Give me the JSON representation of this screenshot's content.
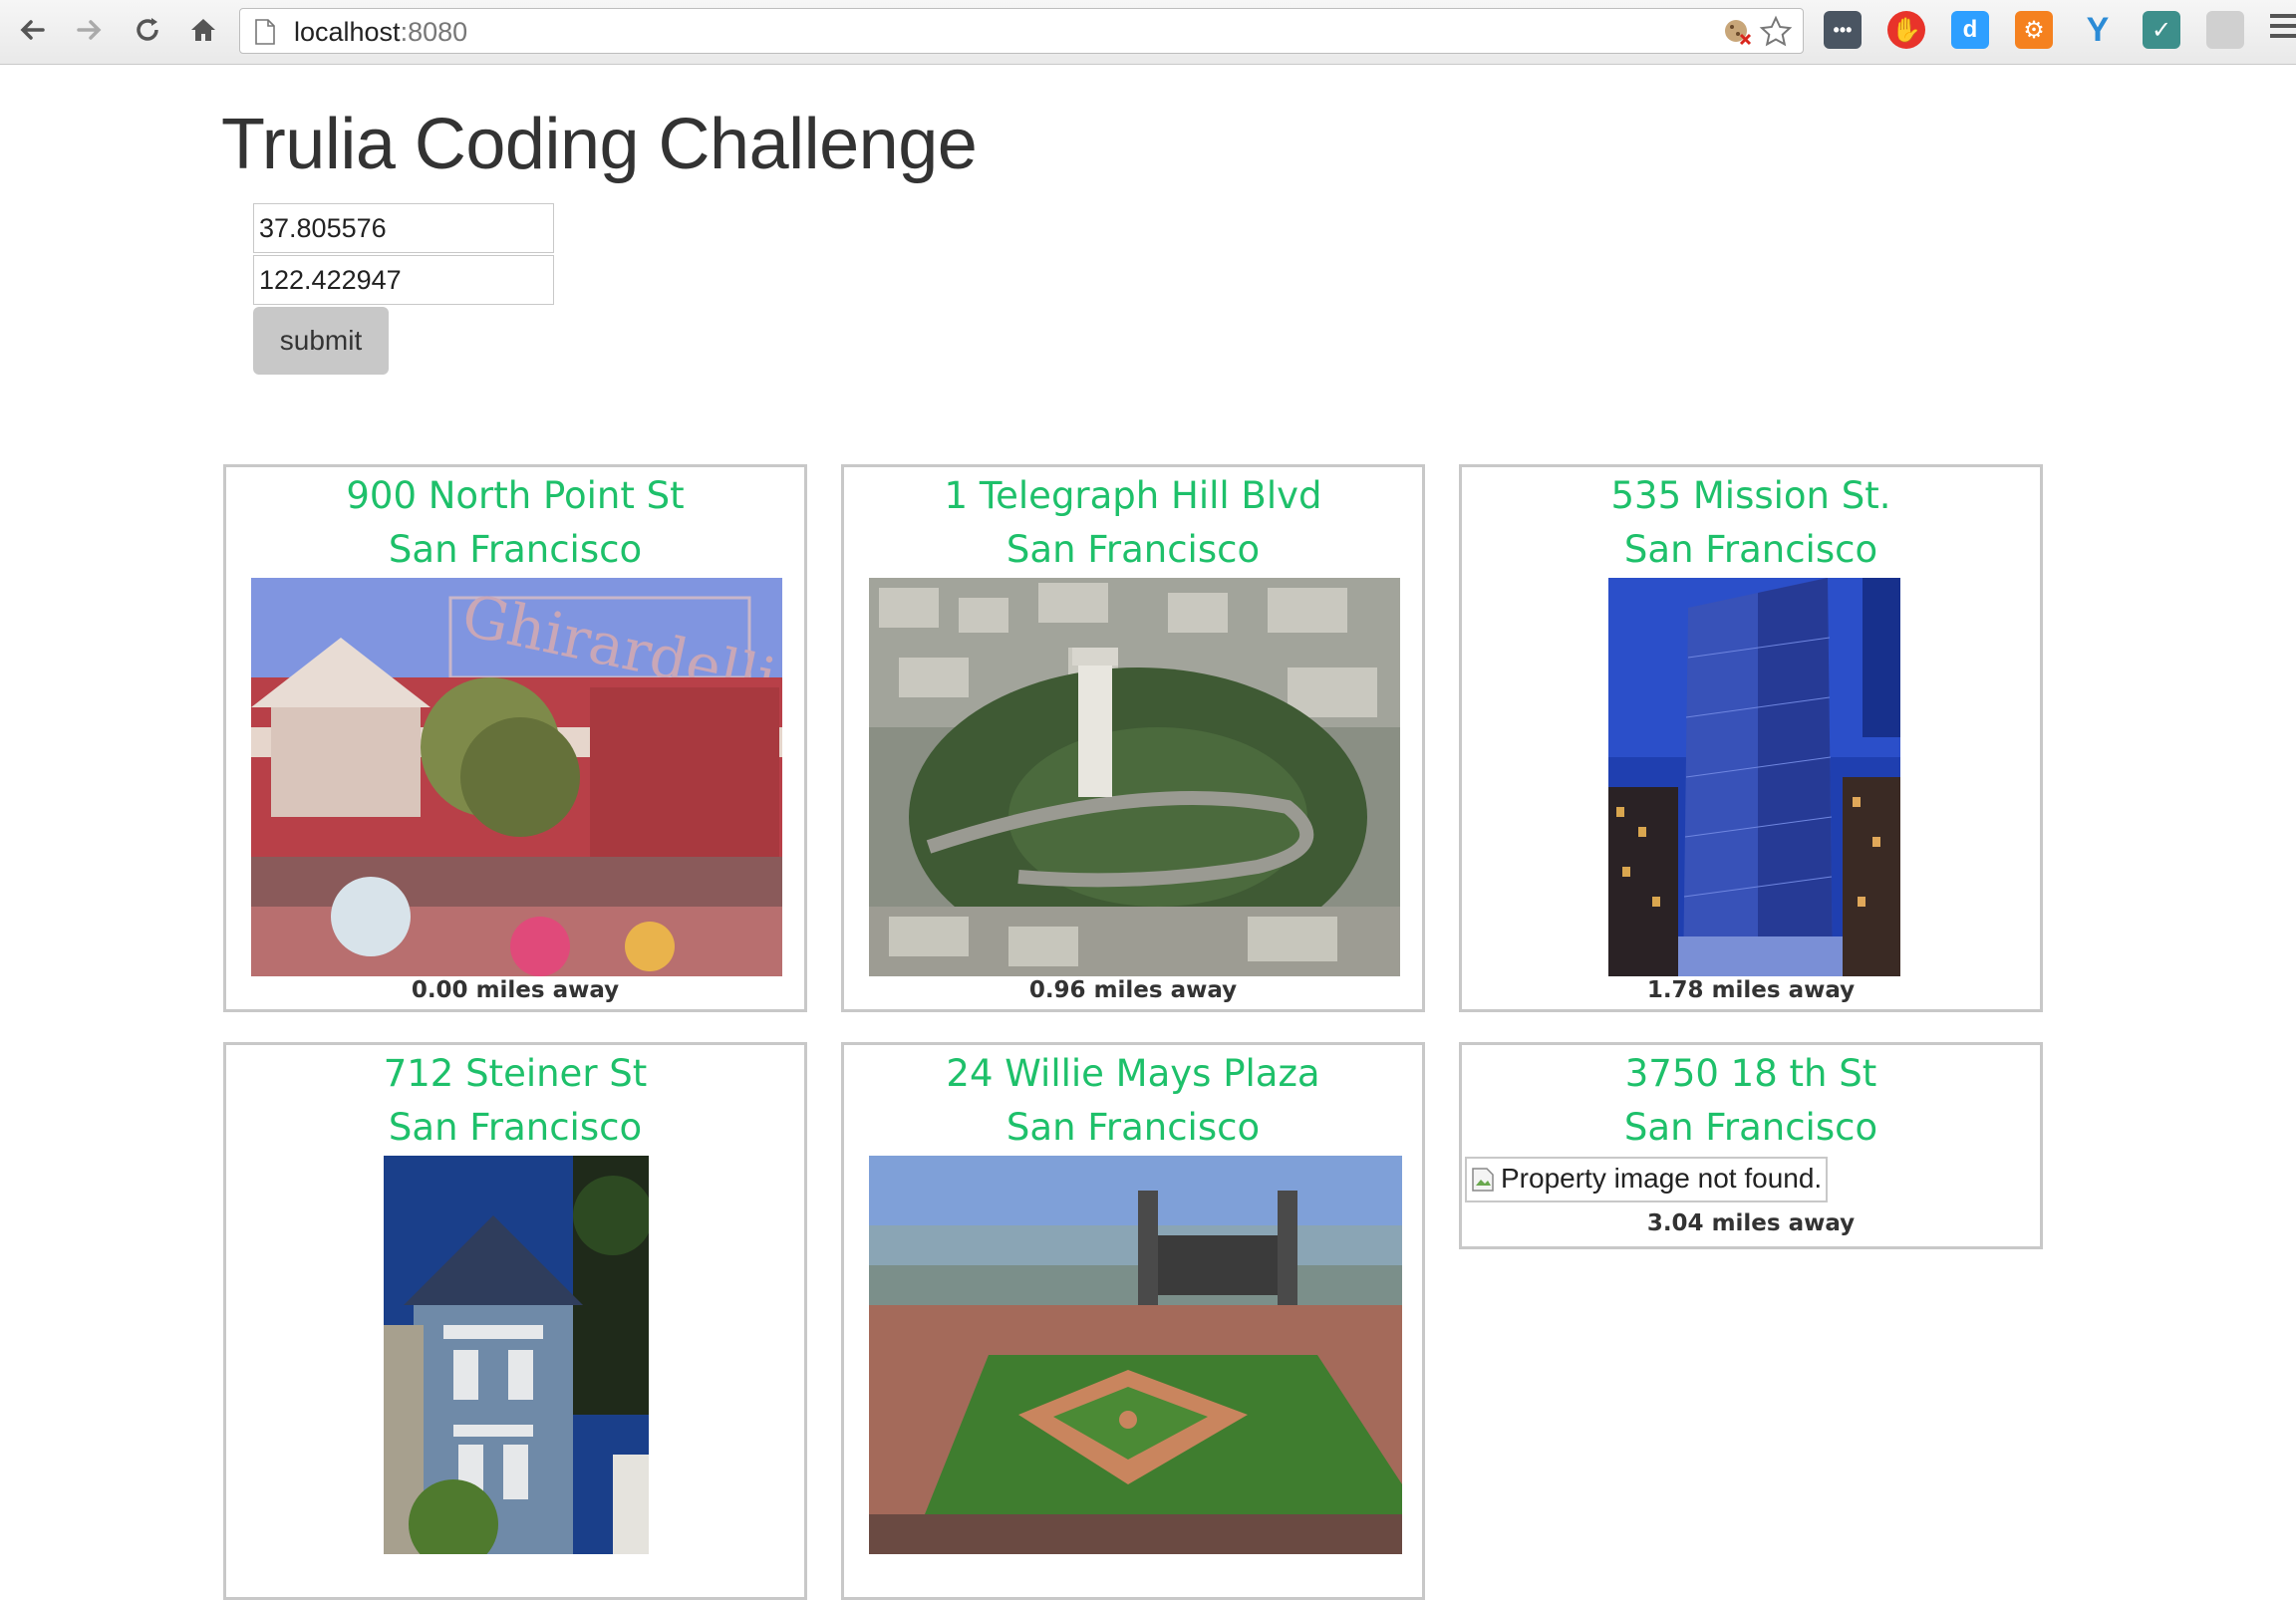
{
  "browser": {
    "url_host": "localhost",
    "url_port": ":8080",
    "icons": [
      "back-icon",
      "forward-icon",
      "reload-icon",
      "home-icon",
      "page-icon",
      "cookie-blocked-icon",
      "bookmark-star-icon",
      "menu-icon"
    ],
    "extensions": [
      {
        "name": "ellipsis-extension",
        "glyph": "•••",
        "color": "#4a5562"
      },
      {
        "name": "adblock-extension",
        "glyph": "✋",
        "color": "#e8332a"
      },
      {
        "name": "disqus-extension",
        "glyph": "d",
        "color": "#2e9fff"
      },
      {
        "name": "hubspot-extension",
        "glyph": "⚙",
        "color": "#f5811f"
      },
      {
        "name": "y-extension",
        "glyph": "Y",
        "color": "#2b8bd6"
      },
      {
        "name": "checklist-extension",
        "glyph": "✓",
        "color": "#3d8f8b"
      },
      {
        "name": "grey-extension",
        "glyph": "",
        "color": "#d0d0d0"
      }
    ]
  },
  "page": {
    "title": "Trulia Coding Challenge",
    "form": {
      "latitude_value": "37.805576",
      "longitude_value": "122.422947",
      "submit_label": "submit"
    }
  },
  "listings": [
    {
      "address": "900 North Point St",
      "city": "San Francisco",
      "distance": "0.00 miles away",
      "image": "ghirardelli-square-photo"
    },
    {
      "address": "1 Telegraph Hill Blvd",
      "city": "San Francisco",
      "distance": "0.96 miles away",
      "image": "coit-tower-aerial-photo"
    },
    {
      "address": "535 Mission St.",
      "city": "San Francisco",
      "distance": "1.78 miles away",
      "image": "glass-tower-photo"
    },
    {
      "address": "712 Steiner St",
      "city": "San Francisco",
      "distance": "",
      "image": "victorian-house-photo"
    },
    {
      "address": "24 Willie Mays Plaza",
      "city": "San Francisco",
      "distance": "",
      "image": "ballpark-photo"
    },
    {
      "address": "3750 18 th St",
      "city": "San Francisco",
      "distance": "3.04 miles away",
      "image_alt": "Property image not found."
    }
  ]
}
